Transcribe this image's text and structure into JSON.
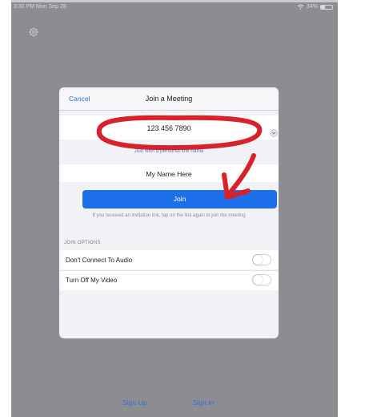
{
  "status": {
    "time": "3:30 PM  Mon Sep 28",
    "battery": "34%",
    "battery_level": 0.34
  },
  "dialog": {
    "cancel_label": "Cancel",
    "title": "Join a Meeting",
    "meeting_id": "123 456 7890",
    "personal_link_label": "Join with a personal link name",
    "name_value": "My Name Here",
    "join_label": "Join",
    "hint": "If you received an invitation link, tap on the link again to join the meeting",
    "options_header": "JOIN OPTIONS",
    "options": [
      {
        "label": "Don't Connect To Audio",
        "on": false
      },
      {
        "label": "Turn Off My Video",
        "on": false
      }
    ]
  },
  "bottom": {
    "sign_up": "Sign Up",
    "sign_in": "Sign In"
  },
  "colors": {
    "accent": "#1c6fe8",
    "link": "#2d6fd2",
    "annotation": "#d8222b",
    "backdrop": "#8b8d92"
  },
  "icons": {
    "settings": "gear-icon",
    "dropdown": "chevron-down-icon",
    "wifi": "wifi-icon",
    "battery": "battery-icon"
  }
}
